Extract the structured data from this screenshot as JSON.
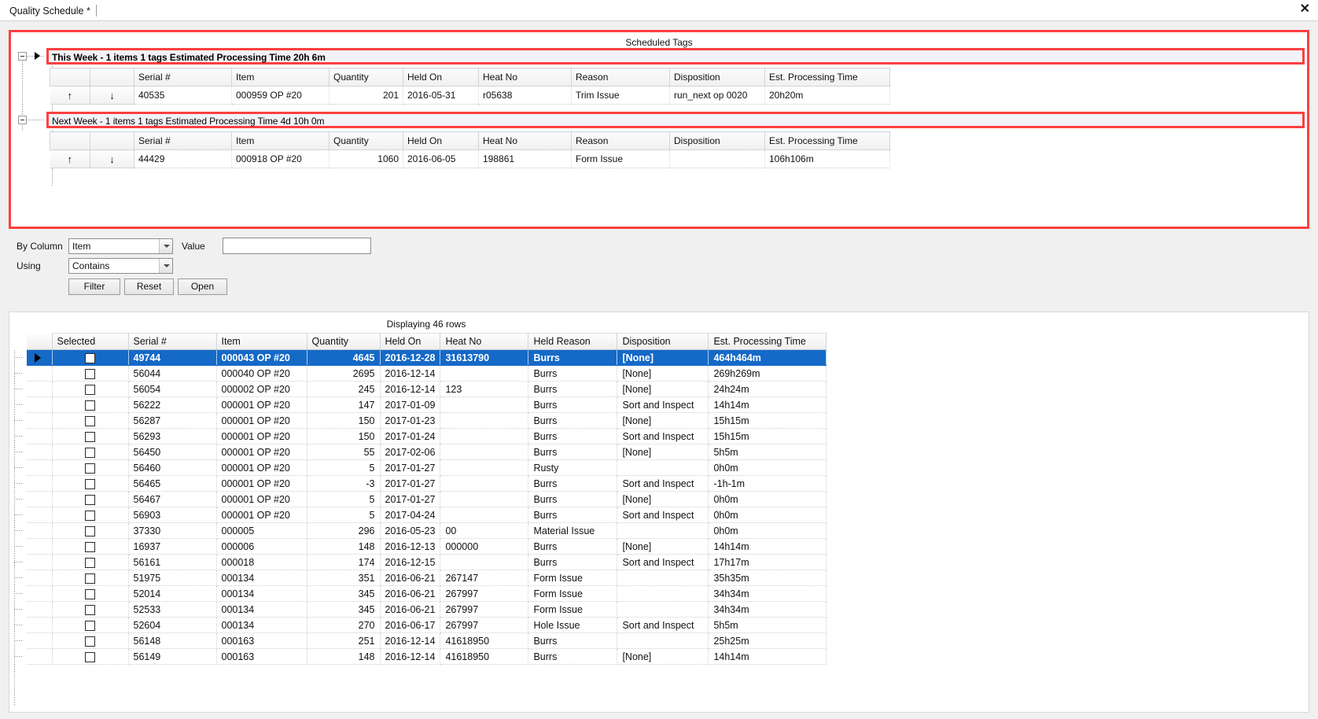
{
  "window": {
    "tab_label": "Quality Schedule *",
    "close_icon": "close-icon",
    "accent_highlight": "#fc4040",
    "selection_color": "#1569c7"
  },
  "scheduled": {
    "title": "Scheduled Tags",
    "groups": [
      {
        "header": "This Week - 1 items 1 tags  Estimated Processing Time 20h 6m",
        "selected": true,
        "columns": [
          "",
          "",
          "Serial #",
          "Item",
          "Quantity",
          "Held On",
          "Heat No",
          "Reason",
          "Disposition",
          "Est. Processing Time"
        ],
        "rows": [
          {
            "up": "↑",
            "down": "↓",
            "serial": "40535",
            "item": "000959 OP #20",
            "quantity": "201",
            "held_on": "2016-05-31",
            "heat_no": "r05638",
            "reason": "Trim Issue",
            "disposition": "run_next op 0020",
            "est_time": "20h20m"
          }
        ]
      },
      {
        "header": "Next Week - 1 items 1 tags  Estimated Processing Time 4d 10h 0m",
        "selected": false,
        "columns": [
          "",
          "",
          "Serial #",
          "Item",
          "Quantity",
          "Held On",
          "Heat No",
          "Reason",
          "Disposition",
          "Est. Processing Time"
        ],
        "rows": [
          {
            "up": "↑",
            "down": "↓",
            "serial": "44429",
            "item": "000918 OP #20",
            "quantity": "1060",
            "held_on": "2016-06-05",
            "heat_no": "198861",
            "reason": "Form Issue",
            "disposition": "",
            "est_time": "106h106m"
          }
        ]
      }
    ]
  },
  "filter": {
    "by_column_label": "By Column",
    "by_column_value": "Item",
    "using_label": "Using",
    "using_value": "Contains",
    "value_label": "Value",
    "value_text": "",
    "value_placeholder": "",
    "filter_button": "Filter",
    "reset_button": "Reset",
    "open_button": "Open"
  },
  "grid": {
    "status": "Displaying 46 rows",
    "columns": [
      "Selected",
      "Serial #",
      "Item",
      "Quantity",
      "Held On",
      "Heat No",
      "Held Reason",
      "Disposition",
      "Est. Processing Time"
    ],
    "rows": [
      {
        "selected": true,
        "serial": "49744",
        "item": "000043 OP #20",
        "quantity": "4645",
        "held_on": "2016-12-28",
        "heat_no": "31613790",
        "reason": "Burrs",
        "disposition": "[None]",
        "est_time": "464h464m"
      },
      {
        "selected": false,
        "serial": "56044",
        "item": "000040 OP #20",
        "quantity": "2695",
        "held_on": "2016-12-14",
        "heat_no": "",
        "reason": "Burrs",
        "disposition": "[None]",
        "est_time": "269h269m"
      },
      {
        "selected": false,
        "serial": "56054",
        "item": "000002 OP #20",
        "quantity": "245",
        "held_on": "2016-12-14",
        "heat_no": "123",
        "reason": "Burrs",
        "disposition": "[None]",
        "est_time": "24h24m"
      },
      {
        "selected": false,
        "serial": "56222",
        "item": "000001 OP #20",
        "quantity": "147",
        "held_on": "2017-01-09",
        "heat_no": "",
        "reason": "Burrs",
        "disposition": "Sort and Inspect",
        "est_time": "14h14m"
      },
      {
        "selected": false,
        "serial": "56287",
        "item": "000001 OP #20",
        "quantity": "150",
        "held_on": "2017-01-23",
        "heat_no": "",
        "reason": "Burrs",
        "disposition": "[None]",
        "est_time": "15h15m"
      },
      {
        "selected": false,
        "serial": "56293",
        "item": "000001 OP #20",
        "quantity": "150",
        "held_on": "2017-01-24",
        "heat_no": "",
        "reason": "Burrs",
        "disposition": "Sort and Inspect",
        "est_time": "15h15m"
      },
      {
        "selected": false,
        "serial": "56450",
        "item": "000001 OP #20",
        "quantity": "55",
        "held_on": "2017-02-06",
        "heat_no": "",
        "reason": "Burrs",
        "disposition": "[None]",
        "est_time": "5h5m"
      },
      {
        "selected": false,
        "serial": "56460",
        "item": "000001 OP #20",
        "quantity": "5",
        "held_on": "2017-01-27",
        "heat_no": "",
        "reason": "Rusty",
        "disposition": "",
        "est_time": "0h0m"
      },
      {
        "selected": false,
        "serial": "56465",
        "item": "000001 OP #20",
        "quantity": "-3",
        "held_on": "2017-01-27",
        "heat_no": "",
        "reason": "Burrs",
        "disposition": "Sort and Inspect",
        "est_time": "-1h-1m"
      },
      {
        "selected": false,
        "serial": "56467",
        "item": "000001 OP #20",
        "quantity": "5",
        "held_on": "2017-01-27",
        "heat_no": "",
        "reason": "Burrs",
        "disposition": "[None]",
        "est_time": "0h0m"
      },
      {
        "selected": false,
        "serial": "56903",
        "item": "000001 OP #20",
        "quantity": "5",
        "held_on": "2017-04-24",
        "heat_no": "",
        "reason": "Burrs",
        "disposition": "Sort and Inspect",
        "est_time": "0h0m"
      },
      {
        "selected": false,
        "serial": "37330",
        "item": "000005",
        "quantity": "296",
        "held_on": "2016-05-23",
        "heat_no": "00",
        "reason": "Material Issue",
        "disposition": "",
        "est_time": "0h0m"
      },
      {
        "selected": false,
        "serial": "16937",
        "item": "000006",
        "quantity": "148",
        "held_on": "2016-12-13",
        "heat_no": "000000",
        "reason": "Burrs",
        "disposition": "[None]",
        "est_time": "14h14m"
      },
      {
        "selected": false,
        "serial": "56161",
        "item": "000018",
        "quantity": "174",
        "held_on": "2016-12-15",
        "heat_no": "",
        "reason": "Burrs",
        "disposition": "Sort and Inspect",
        "est_time": "17h17m"
      },
      {
        "selected": false,
        "serial": "51975",
        "item": "000134",
        "quantity": "351",
        "held_on": "2016-06-21",
        "heat_no": "267147",
        "reason": "Form Issue",
        "disposition": "",
        "est_time": "35h35m"
      },
      {
        "selected": false,
        "serial": "52014",
        "item": "000134",
        "quantity": "345",
        "held_on": "2016-06-21",
        "heat_no": "267997",
        "reason": "Form Issue",
        "disposition": "",
        "est_time": "34h34m"
      },
      {
        "selected": false,
        "serial": "52533",
        "item": "000134",
        "quantity": "345",
        "held_on": "2016-06-21",
        "heat_no": "267997",
        "reason": "Form Issue",
        "disposition": "",
        "est_time": "34h34m"
      },
      {
        "selected": false,
        "serial": "52604",
        "item": "000134",
        "quantity": "270",
        "held_on": "2016-06-17",
        "heat_no": "267997",
        "reason": "Hole Issue",
        "disposition": "Sort and Inspect",
        "est_time": "5h5m"
      },
      {
        "selected": false,
        "serial": "56148",
        "item": "000163",
        "quantity": "251",
        "held_on": "2016-12-14",
        "heat_no": "41618950",
        "reason": "Burrs",
        "disposition": "",
        "est_time": "25h25m"
      },
      {
        "selected": false,
        "serial": "56149",
        "item": "000163",
        "quantity": "148",
        "held_on": "2016-12-14",
        "heat_no": "41618950",
        "reason": "Burrs",
        "disposition": "[None]",
        "est_time": "14h14m"
      }
    ]
  }
}
